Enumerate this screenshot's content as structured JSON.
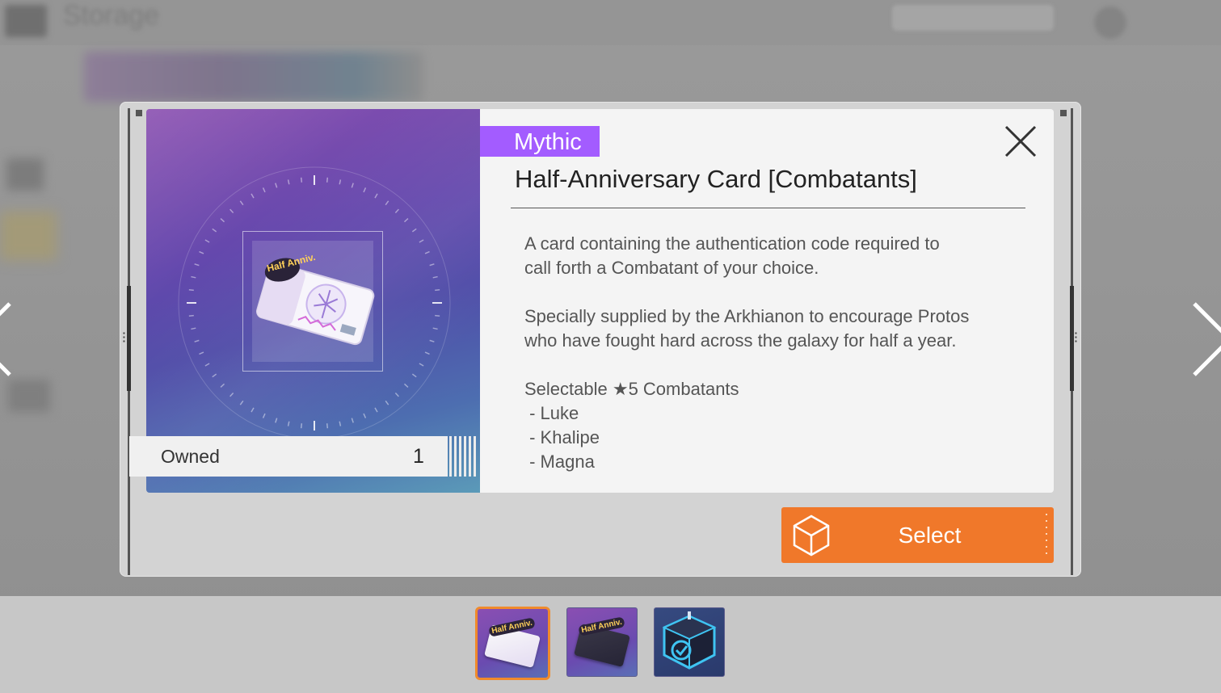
{
  "background": {
    "title": "Storage"
  },
  "modal": {
    "rarity": "Mythic",
    "title": "Half-Anniversary Card [Combatants]",
    "description": [
      "A card containing the authentication code required to",
      "call forth a Combatant of your choice.",
      "",
      "Specially supplied by the Arkhianon to encourage Protos",
      "who have fought hard across the galaxy for half a year.",
      "",
      "Selectable ★5 Combatants",
      " - Luke",
      " - Khalipe",
      " - Magna"
    ],
    "owned_label": "Owned",
    "owned_count": "1",
    "select_label": "Select",
    "card_badge": "Half Anniv.",
    "colors": {
      "rarity": "#a35cff",
      "select_button": "#f0782a",
      "selected_thumb_border": "#f08a2c"
    }
  },
  "thumbnails": [
    {
      "name": "half-anniversary-card-combatants",
      "selected": true,
      "badge": "Half Anniv."
    },
    {
      "name": "half-anniversary-card-dark",
      "selected": false,
      "badge": "Half Anniv."
    },
    {
      "name": "selection-box",
      "selected": false
    }
  ],
  "icons": {
    "close": "close-icon",
    "select": "cube-icon",
    "prev": "chevron-left-icon",
    "next": "chevron-right-icon"
  }
}
